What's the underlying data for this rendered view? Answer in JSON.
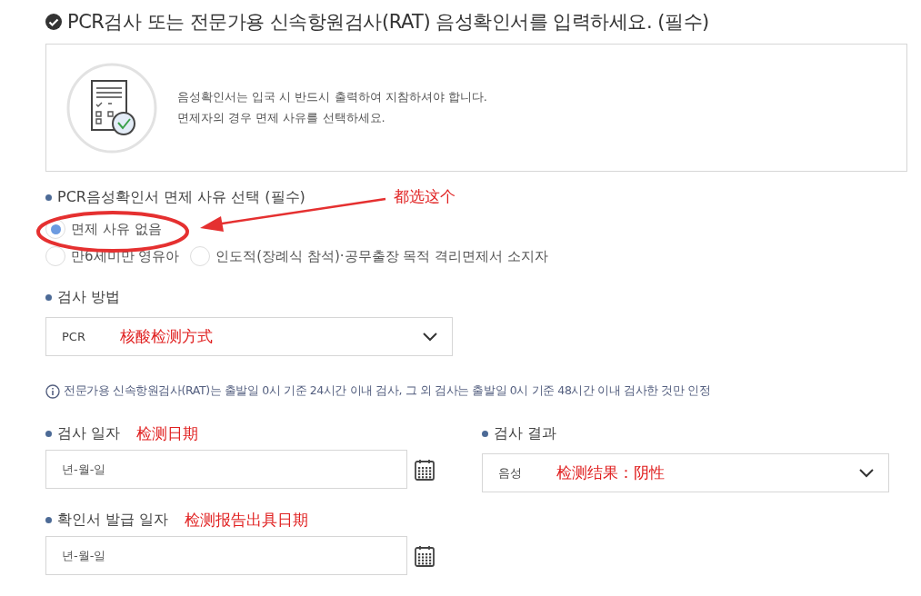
{
  "heading": {
    "title": "PCR검사 또는 전문가용 신속항원검사(RAT) 음성확인서를 입력하세요. (필수)"
  },
  "notice": {
    "lines": [
      "음성확인서는 입국 시 반드시 출력하여 지참하셔야 합니다.",
      "면제자의 경우 면제 사유를 선택하세요."
    ]
  },
  "exemption": {
    "label": "PCR음성확인서 면제 사유 선택 (필수)",
    "annotation": "都选这个",
    "option_rows": [
      [
        {
          "label": "면제 사유 없음",
          "selected": true
        }
      ],
      [
        {
          "label": "만6세미만 영유아",
          "selected": false
        },
        {
          "label": "인도적(장례식 참석)·공무출장 목적 격리면제서 소지자",
          "selected": false
        }
      ]
    ]
  },
  "method": {
    "label": "검사 방법",
    "value": "PCR",
    "annotation": "核酸检测方式"
  },
  "info_note": "전문가용 신속항원검사(RAT)는 출발일 0시 기준 24시간 이내 검사, 그 외 검사는 출발일 0시 기준 48시간 이내 검사한 것만 인정",
  "test_date": {
    "label": "검사 일자",
    "placeholder": "년-월-일",
    "annotation": "检测日期"
  },
  "result": {
    "label": "검사 결과",
    "value": "음성",
    "annotation": "检测结果：阴性"
  },
  "issue_date": {
    "label": "확인서 발급 일자",
    "placeholder": "년-월-일",
    "annotation": "检测报告出具日期"
  }
}
